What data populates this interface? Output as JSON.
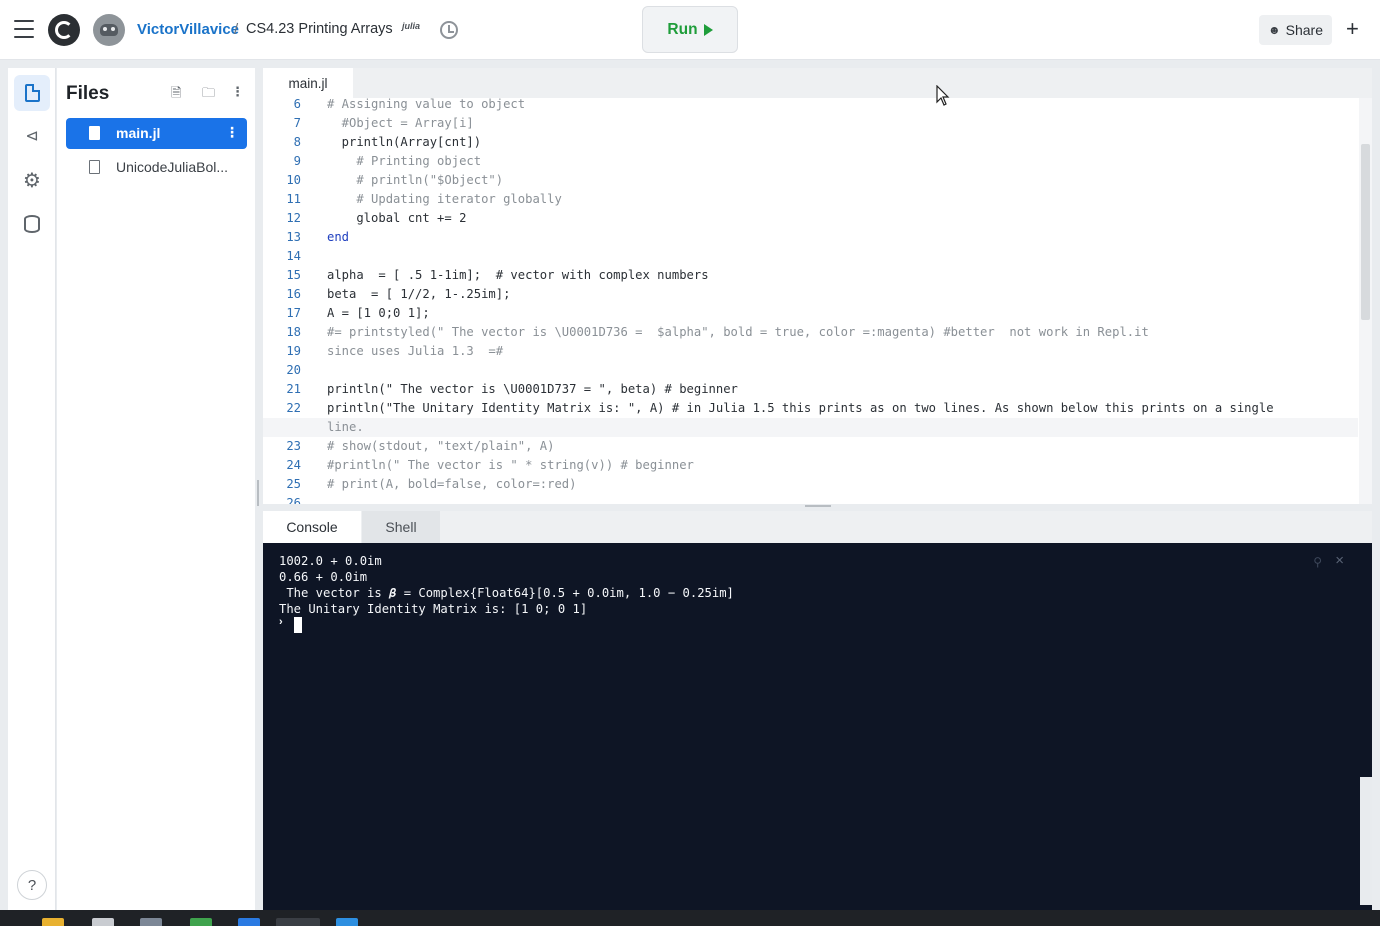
{
  "header": {
    "owner": "VictorVillavice",
    "separator": "/",
    "repl_name": "CS4.23 Printing Arrays",
    "lang_badge": "julia",
    "run_label": "Run",
    "share_label": "Share",
    "plus_label": "+"
  },
  "sidebar": {
    "rail_items": [
      {
        "name": "files-icon"
      },
      {
        "name": "version-control-icon"
      },
      {
        "name": "settings-icon"
      },
      {
        "name": "database-icon"
      }
    ],
    "help_label": "?"
  },
  "files": {
    "title": "Files",
    "items": [
      {
        "name": "main.jl",
        "active": true
      },
      {
        "name": "UnicodeJuliaBol...",
        "active": false
      }
    ]
  },
  "editor": {
    "tab": "main.jl",
    "lines": [
      {
        "n": "6",
        "text": "# Assigning value to object"
      },
      {
        "n": "7",
        "text": "  #Object = Array[i]"
      },
      {
        "n": "8",
        "text": "  println(Array[cnt])"
      },
      {
        "n": "9",
        "text": "    # Printing object"
      },
      {
        "n": "10",
        "text": "    # println(\"$Object\")"
      },
      {
        "n": "11",
        "text": "    # Updating iterator globally"
      },
      {
        "n": "12",
        "text": "    global cnt += 2"
      },
      {
        "n": "13",
        "text": "end"
      },
      {
        "n": "14",
        "text": ""
      },
      {
        "n": "15",
        "text": "alpha  = [ .5 1-1im];  # vector with complex numbers"
      },
      {
        "n": "16",
        "text": "beta  = [ 1//2, 1-.25im];"
      },
      {
        "n": "17",
        "text": "A = [1 0;0 1];"
      },
      {
        "n": "18",
        "text": "#= printstyled(\" The vector is \\U0001D736 =  $alpha\", bold = true, color =:magenta) #better  not work in Repl.it"
      },
      {
        "n": "",
        "text": "since uses Julia 1.3  =#"
      },
      {
        "n": "20",
        "text": ""
      },
      {
        "n": "21",
        "text": "println(\" The vector is \\U0001D737 = \", beta) # beginner"
      },
      {
        "n": "22",
        "text": "println(\"The Unitary Identity Matrix is: \", A) # in Julia 1.5 this prints as on two lines. As shown below this prints on a single"
      },
      {
        "n": "",
        "text": "line."
      },
      {
        "n": "23",
        "text": "# show(stdout, \"text/plain\", A)"
      },
      {
        "n": "24",
        "text": "#println(\" The vector is \" * string(v)) # beginner"
      },
      {
        "n": "25",
        "text": "# print(A, bold=false, color=:red)"
      },
      {
        "n": "26",
        "text": ""
      }
    ],
    "line19_number": "19"
  },
  "console": {
    "tabs": [
      "Console",
      "Shell"
    ],
    "output": [
      "1002.0 + 0.0im",
      "0.66 + 0.0im",
      " The vector is 𝜷 = Complex{Float64}[0.5 + 0.0im, 1.0 − 0.25im]",
      "The Unitary Identity Matrix is: [1 0; 0 1]"
    ],
    "prompt": "›"
  },
  "colors": {
    "accent": "#1a73e8",
    "run_green": "#1f9d3a",
    "console_bg": "#0e1525"
  }
}
